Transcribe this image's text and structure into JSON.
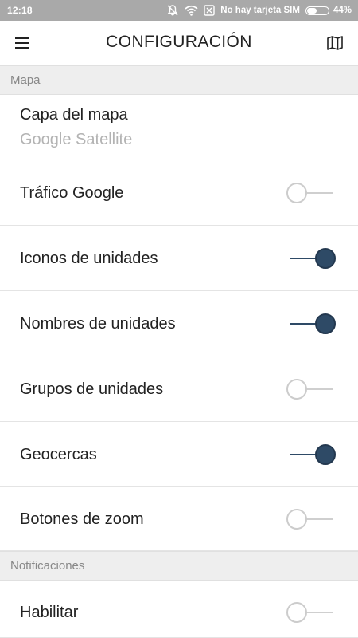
{
  "status_bar": {
    "time": "12:18",
    "sim_text": "No hay tarjeta SIM",
    "battery_percent": "44%",
    "battery_level": 0.44,
    "icons": [
      "notifications-off-icon",
      "wifi-icon",
      "no-sim-icon",
      "battery-icon"
    ]
  },
  "app_bar": {
    "title": "CONFIGURACIÓN",
    "left_icon": "menu-icon",
    "right_icon": "map-icon"
  },
  "sections": {
    "map": {
      "title": "Mapa"
    },
    "notifications": {
      "title": "Notificaciones"
    }
  },
  "map_layer": {
    "label": "Capa del mapa",
    "value": "Google Satellite"
  },
  "settings": [
    {
      "label": "Tráfico Google",
      "enabled": false
    },
    {
      "label": "Iconos de unidades",
      "enabled": true
    },
    {
      "label": "Nombres de unidades",
      "enabled": true
    },
    {
      "label": "Grupos de unidades",
      "enabled": false
    },
    {
      "label": "Geocercas",
      "enabled": true
    },
    {
      "label": "Botones de zoom",
      "enabled": false
    }
  ],
  "notifications": [
    {
      "label": "Habilitar",
      "enabled": false
    }
  ],
  "colors": {
    "status_bar": "#a9a9a9",
    "accent": "#2e4a66",
    "section_bg": "#eeeeee",
    "secondary_text": "#b3b3b3"
  }
}
